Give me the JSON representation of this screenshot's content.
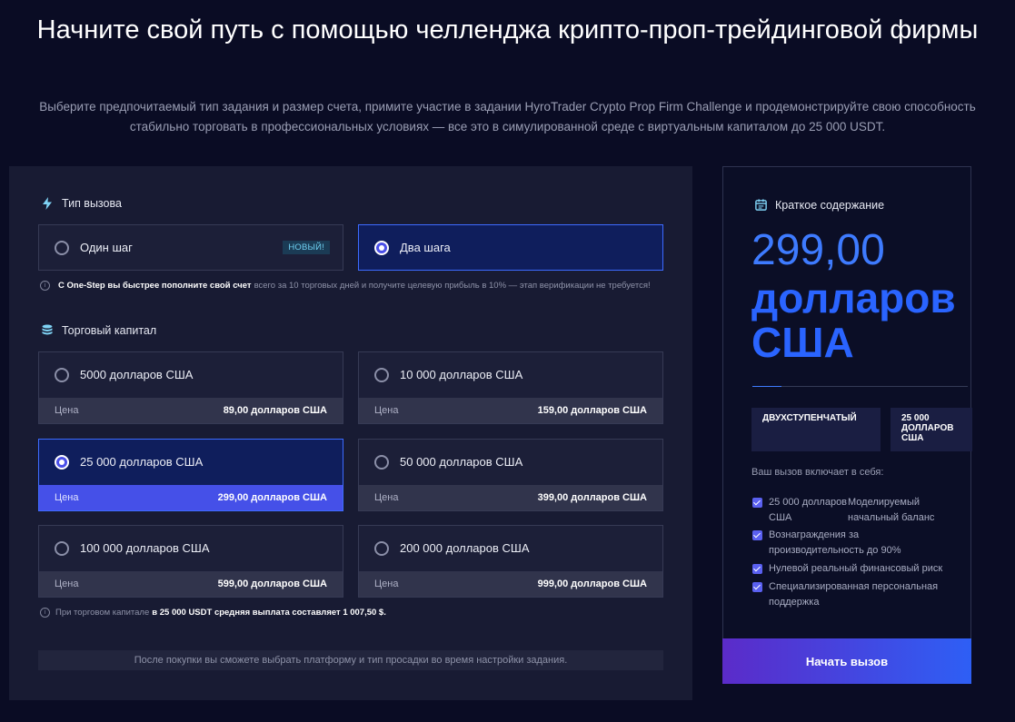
{
  "hero": {
    "title": "Начните свой путь с помощью челленджа крипто-проп-трейдинговой фирмы",
    "subtitle": "Выберите предпочитаемый тип задания и размер счета, примите участие в задании HyroTrader Crypto Prop Firm Challenge и продемонстрируйте свою способность стабильно торговать в профессиональных условиях — все это в симулированной среде с виртуальным капиталом до 25 000 USDT."
  },
  "challenge_type": {
    "heading": "Тип вызова",
    "options": [
      {
        "label": "Один шаг",
        "badge": "НОВЫЙ!",
        "selected": false
      },
      {
        "label": "Два шага",
        "selected": true
      }
    ],
    "note_bold": "С One-Step вы быстрее пополните свой счет",
    "note_rest": "всего за 10 торговых дней и получите целевую прибыль в 10% — этап верификации не требуется!"
  },
  "capital": {
    "heading": "Торговый капитал",
    "price_key": "Цена",
    "options": [
      {
        "label": "5000 долларов США",
        "price": "89,00 долларов США",
        "selected": false
      },
      {
        "label": "10 000 долларов США",
        "price": "159,00 долларов США",
        "selected": false
      },
      {
        "label": "25 000 долларов США",
        "price": "299,00 долларов США",
        "selected": true
      },
      {
        "label": "50 000 долларов США",
        "price": "399,00 долларов США",
        "selected": false
      },
      {
        "label": "100 000 долларов США",
        "price": "599,00 долларов США",
        "selected": false
      },
      {
        "label": "200 000 долларов США",
        "price": "999,00 долларов США",
        "selected": false
      }
    ],
    "note_pre": "При торговом капитале",
    "note_bold": "в 25 000 USDT средняя выплата составляет 1 007,50 $."
  },
  "footer_note": "После покупки вы сможете выбрать платформу и тип просадки во время настройки задания.",
  "summary": {
    "heading": "Краткое содержание",
    "price_number": "299,00",
    "price_currency_line1": "долларов",
    "price_currency_line2": "США",
    "tags": [
      "ДВУХСТУПЕНЧАТЫЙ",
      "25 000 ДОЛЛАРОВ США"
    ],
    "includes_label": "Ваш вызов включает в себя:",
    "features": [
      {
        "a": "25 000 долларов США",
        "b": "Моделируемый начальный баланс"
      },
      {
        "a": "Вознаграждения за производительность до 90%"
      },
      {
        "a": "Нулевой реальный финансовый риск"
      },
      {
        "a": "Специализированная персональная поддержка"
      }
    ],
    "cta": "Начать вызов"
  },
  "colors": {
    "background": "#0a0c24",
    "panel": "#181b33",
    "accent_blue": "#3e7bff",
    "selected_price_bar": "#4550e8",
    "badge_text": "#6fd0f2"
  }
}
